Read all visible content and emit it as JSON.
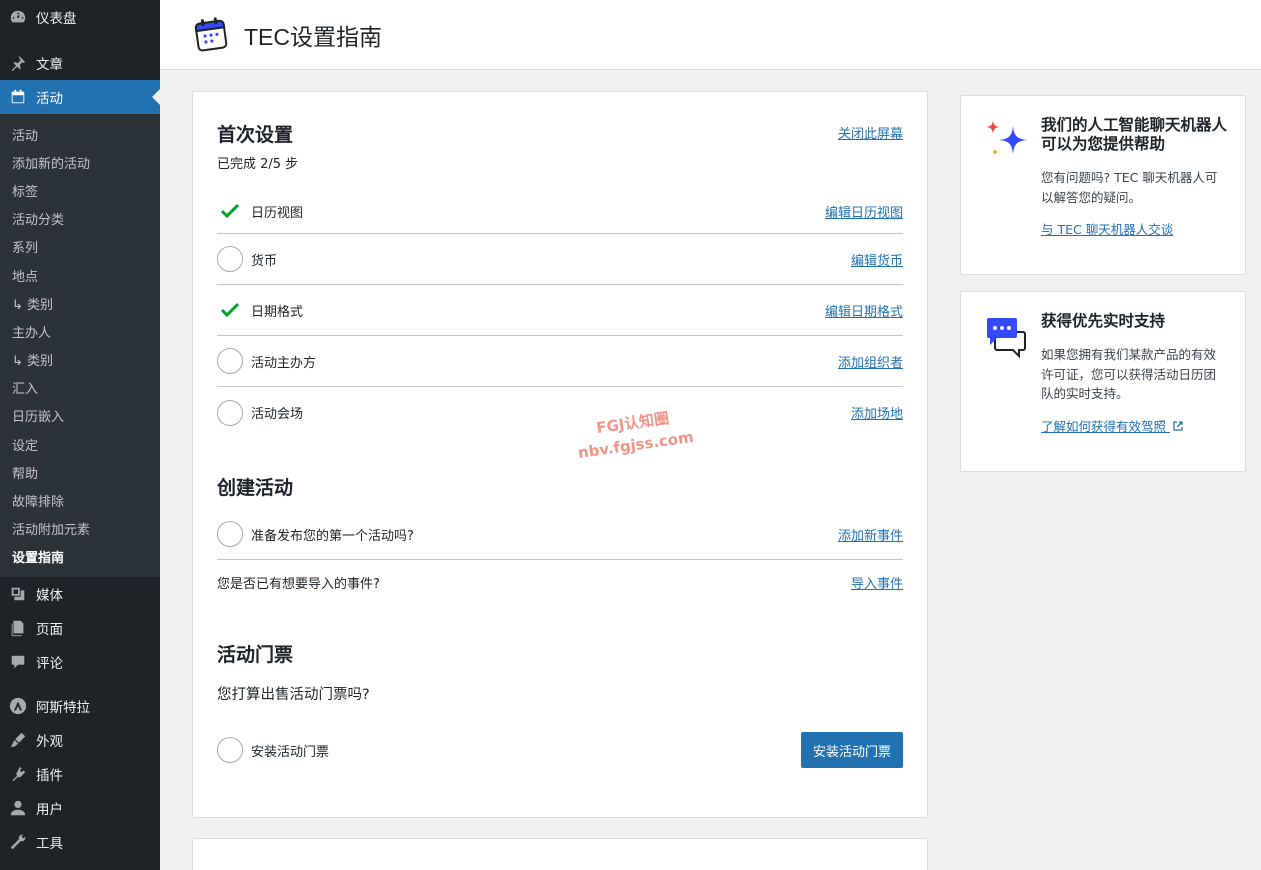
{
  "header": {
    "title": "TEC设置指南"
  },
  "sidebar": {
    "top_before": [
      {
        "label": "仪表盘",
        "icon": "dashboard-icon"
      },
      {
        "label": "文章",
        "icon": "pin-icon"
      }
    ],
    "current": {
      "label": "活动",
      "icon": "calendar-icon"
    },
    "submenu": [
      "活动",
      "添加新的活动",
      "标签",
      "活动分类",
      "系列",
      "地点",
      "↳ 类别",
      "主办人",
      "↳ 类别",
      "汇入",
      "日历嵌入",
      "设定",
      "帮助",
      "故障排除",
      "活动附加元素",
      "设置指南"
    ],
    "top_after": [
      {
        "label": "媒体",
        "icon": "media-icon"
      },
      {
        "label": "页面",
        "icon": "page-icon"
      },
      {
        "label": "评论",
        "icon": "comment-icon"
      },
      {
        "label": "阿斯特拉",
        "icon": "astra-icon"
      },
      {
        "label": "外观",
        "icon": "brush-icon"
      },
      {
        "label": "插件",
        "icon": "plugin-icon"
      },
      {
        "label": "用户",
        "icon": "user-icon"
      },
      {
        "label": "工具",
        "icon": "wrench-icon"
      }
    ]
  },
  "first_setup": {
    "title": "首次设置",
    "progress": "已完成 2/5 步",
    "dismiss_link": "关闭此屏幕",
    "steps": [
      {
        "label": "日历视图",
        "done": true,
        "link": "编辑日历视图"
      },
      {
        "label": "货币",
        "done": false,
        "link": "编辑货币"
      },
      {
        "label": "日期格式",
        "done": true,
        "link": "编辑日期格式"
      },
      {
        "label": "活动主办方",
        "done": false,
        "link": "添加组织者"
      },
      {
        "label": "活动会场",
        "done": false,
        "link": "添加场地"
      }
    ]
  },
  "create_event": {
    "title": "创建活动",
    "publish_label": "准备发布您的第一个活动吗?",
    "publish_link": "添加新事件",
    "import_label": "您是否已有想要导入的事件?",
    "import_link": "导入事件"
  },
  "tickets": {
    "title": "活动门票",
    "question": "您打算出售活动门票吗?",
    "install_label": "安装活动门票",
    "install_button": "安装活动门票"
  },
  "chatbot_card": {
    "title": "我们的人工智能聊天机器人可以为您提供帮助",
    "text": "您有问题吗? TEC 聊天机器人可以解答您的疑问。",
    "link": "与 TEC 聊天机器人交谈"
  },
  "support_card": {
    "title": "获得优先实时支持",
    "text": "如果您拥有我们某款产品的有效许可证，您可以获得活动日历团队的实时支持。",
    "link": "了解如何获得有效驾照"
  },
  "watermark": {
    "line1": "FGJ认知圈",
    "line2": "nbv.fgjss.com"
  },
  "colors": {
    "accent": "#2271b1",
    "sidebar_bg": "#1d2327",
    "check_green": "#00a32a"
  }
}
